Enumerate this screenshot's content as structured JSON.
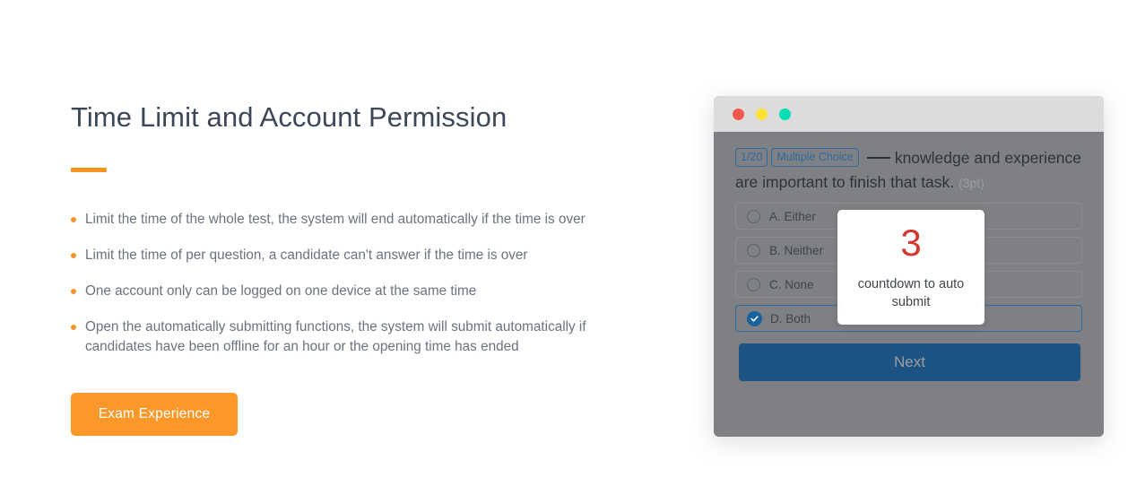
{
  "left": {
    "title": "Time Limit and Account Permission",
    "features": [
      "Limit the time of the whole test, the system will end automatically if the time is over",
      "Limit the time of per question, a candidate can't answer if the time is over",
      "One account only can be logged on one device at the same time",
      "Open the automatically submitting functions, the system will submit automatically if candidates have been offline for an hour or the opening time has ended"
    ],
    "cta_label": "Exam Experience",
    "accent_color": "#f7941e",
    "bullet_color": "#f5952b",
    "cta_color": "#fb9829"
  },
  "mockup": {
    "titlebar": {
      "dots": [
        {
          "name": "close",
          "color": "#f4584c"
        },
        {
          "name": "minimize",
          "color": "#ffe233"
        },
        {
          "name": "maximize",
          "color": "#00e0b4"
        }
      ]
    },
    "question": {
      "index_badge": "1/20",
      "type_badge": "Multiple Choice",
      "text_part_1": "knowledge and experience are important to finish that task.",
      "points": "(3pt)",
      "options": [
        {
          "label": "A. Either",
          "selected": false
        },
        {
          "label": "B. Neither",
          "selected": false
        },
        {
          "label": "C. None",
          "selected": false
        },
        {
          "label": "D. Both",
          "selected": true
        }
      ]
    },
    "next_label": "Next",
    "accent_blue": "#2d6a9f",
    "next_bg": "#1d5382"
  },
  "countdown": {
    "number": "3",
    "label": "countdown to auto submit",
    "number_color": "#d4382f"
  }
}
